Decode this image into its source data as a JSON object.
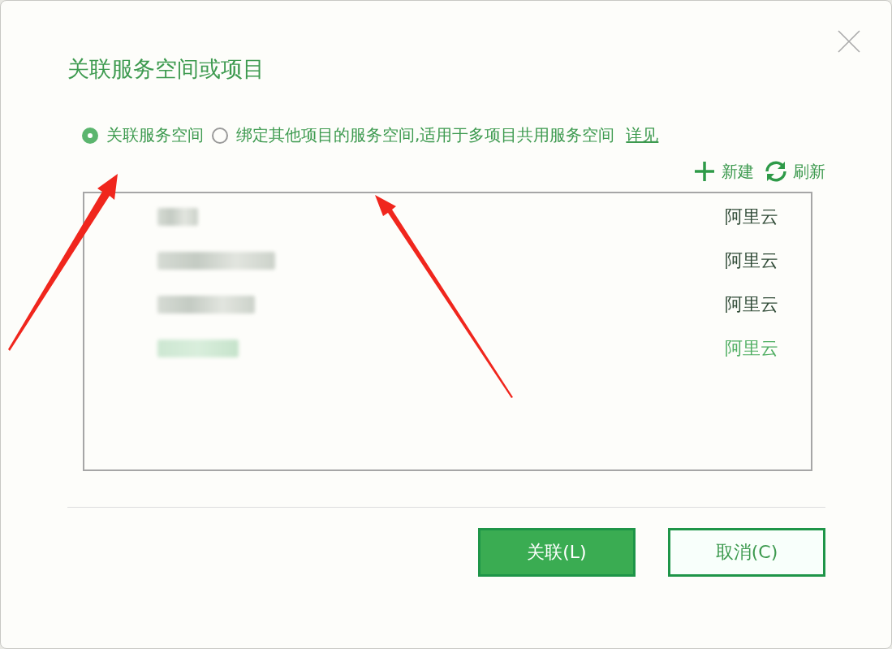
{
  "dialog": {
    "title": "关联服务空间或项目"
  },
  "options": [
    {
      "label": "关联服务空间",
      "selected": true
    },
    {
      "label": "绑定其他项目的服务空间,适用于多项目共用服务空间",
      "selected": false
    }
  ],
  "details_link": "详见",
  "toolbar": [
    {
      "kind": "add",
      "label": "新建"
    },
    {
      "kind": "refresh",
      "label": "刷新"
    }
  ],
  "spaces": [
    {
      "provider": "阿里云",
      "selected": false
    },
    {
      "provider": "阿里云",
      "selected": false
    },
    {
      "provider": "阿里云",
      "selected": false
    },
    {
      "provider": "阿里云",
      "selected": true
    }
  ],
  "buttons": [
    {
      "label": "关联(L)",
      "kind": "primary"
    },
    {
      "label": "取消(C)",
      "kind": "secondary"
    }
  ]
}
